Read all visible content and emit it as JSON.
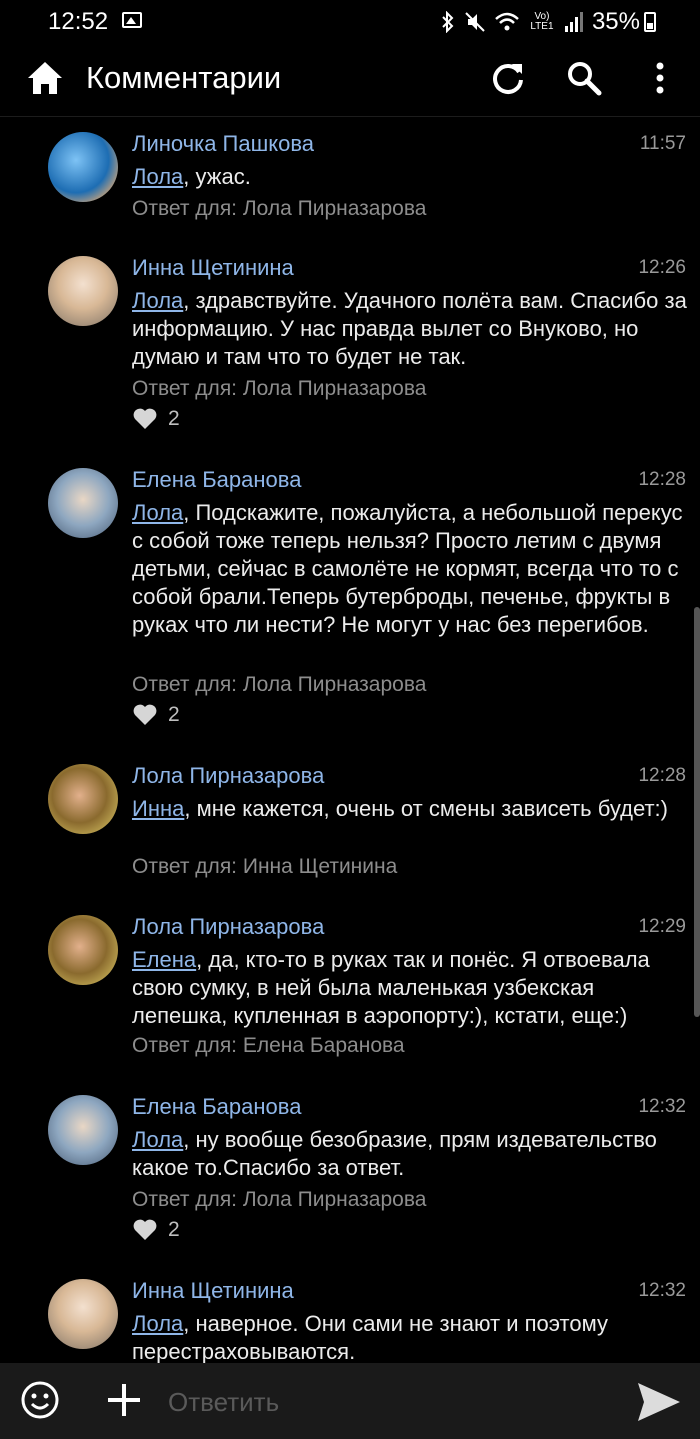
{
  "status_bar": {
    "time": "12:52",
    "battery": "35%",
    "network": "Vo) LTE1",
    "icons": [
      "image-icon",
      "bluetooth-icon",
      "mute-icon",
      "wifi-icon",
      "signal-icon",
      "battery-icon"
    ]
  },
  "header": {
    "title": "Комментарии",
    "icons": [
      "home-icon",
      "refresh-icon",
      "search-icon",
      "more-icon"
    ]
  },
  "comments": [
    {
      "author": "Линочка Пашкова",
      "time": "11:57",
      "mention": "Лола",
      "text": ", ужас.",
      "reply_label": "Ответ для: Лола Пирназарова",
      "likes": ""
    },
    {
      "author": "Инна Щетинина",
      "time": "12:26",
      "mention": "Лола",
      "text": ", здравствуйте. Удачного полёта вам. Спасибо за информацию.  У нас правда вылет со Внуково, но думаю и там что то будет не так.",
      "reply_label": "Ответ для: Лола Пирназарова",
      "likes": "2"
    },
    {
      "author": "Елена Баранова",
      "time": "12:28",
      "mention": "Лола",
      "text": ", Подскажите, пожалуйста, а небольшой перекус с собой тоже теперь нельзя? Просто летим с двумя детьми, сейчас в самолёте не кормят, всегда что то с собой брали.Теперь бутерброды, печенье, фрукты в руках что ли нести? Не могут у нас без перегибов.",
      "reply_label": "Ответ для: Лола Пирназарова",
      "likes": "2"
    },
    {
      "author": "Лола Пирназарова",
      "time": "12:28",
      "mention": "Инна",
      "text": ", мне кажется, очень от смены зависеть будет:)",
      "reply_label": "Ответ для: Инна Щетинина",
      "likes": ""
    },
    {
      "author": "Лола Пирназарова",
      "time": "12:29",
      "mention": "Елена",
      "text": ", да, кто-то в руках так и понёс. Я отвоевала свою сумку, в ней была маленькая узбекская лепешка, купленная в аэропорту:), кстати, еще:)",
      "reply_label": "Ответ для: Елена Баранова",
      "likes": ""
    },
    {
      "author": "Елена Баранова",
      "time": "12:32",
      "mention": "Лола",
      "text": ", ну вообще безобразие, прям издевательство какое то.Спасибо за ответ.",
      "reply_label": "Ответ для: Лола Пирназарова",
      "likes": "2"
    },
    {
      "author": "Инна Щетинина",
      "time": "12:32",
      "mention": "Лола",
      "text": ", наверное. Они сами не знают и поэтому перестраховываются.",
      "reply_label": "",
      "likes": ""
    }
  ],
  "composer": {
    "placeholder": "Ответить",
    "icons": [
      "emoji-icon",
      "plus-icon",
      "send-icon"
    ]
  },
  "colors": {
    "background": "#000000",
    "link": "#8fb6e8",
    "muted": "#8d8d8d",
    "composer": "#1a1a1a"
  }
}
